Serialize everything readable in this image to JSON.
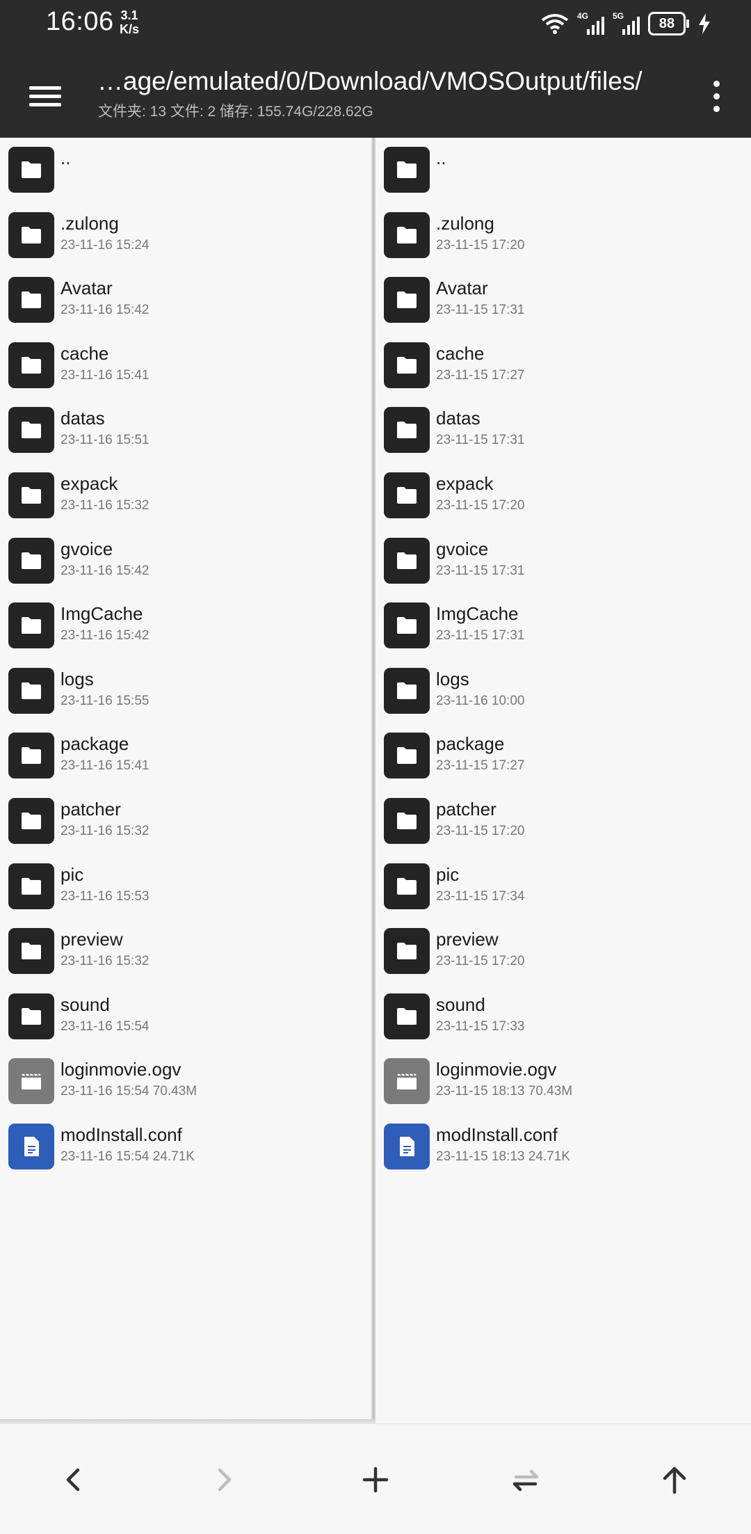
{
  "status_bar": {
    "time": "16:06",
    "speed_value": "3.1",
    "speed_unit": "K/s",
    "net_4g": "4G",
    "net_5g": "5G",
    "battery": "88"
  },
  "appbar": {
    "path": "…age/emulated/0/Download/VMOSOutput/files/",
    "info": "文件夹: 13  文件: 2  储存: 155.74G/228.62G"
  },
  "icons": {
    "menu": "hamburger-icon",
    "more": "more-vertical-icon",
    "folder": "folder-icon",
    "video": "video-icon",
    "doc": "document-icon",
    "back": "chevron-left-icon",
    "forward": "chevron-right-icon",
    "add": "plus-icon",
    "swap": "swap-icon",
    "up": "arrow-up-icon"
  },
  "colors": {
    "topbar": "#2b2b2b",
    "folder_icon": "#242424",
    "video_icon": "#7a7a7a",
    "doc_icon": "#2f5eb8"
  },
  "left_pane": {
    "items": [
      {
        "name": "..",
        "meta": ""
      },
      {
        "name": ".zulong",
        "meta": "23-11-16 15:24"
      },
      {
        "name": "Avatar",
        "meta": "23-11-16 15:42"
      },
      {
        "name": "cache",
        "meta": "23-11-16 15:41"
      },
      {
        "name": "datas",
        "meta": "23-11-16 15:51"
      },
      {
        "name": "expack",
        "meta": "23-11-16 15:32"
      },
      {
        "name": "gvoice",
        "meta": "23-11-16 15:42"
      },
      {
        "name": "ImgCache",
        "meta": "23-11-16 15:42"
      },
      {
        "name": "logs",
        "meta": "23-11-16 15:55"
      },
      {
        "name": "package",
        "meta": "23-11-16 15:41"
      },
      {
        "name": "patcher",
        "meta": "23-11-16 15:32"
      },
      {
        "name": "pic",
        "meta": "23-11-16 15:53"
      },
      {
        "name": "preview",
        "meta": "23-11-16 15:32"
      },
      {
        "name": "sound",
        "meta": "23-11-16 15:54"
      },
      {
        "name": "loginmovie.ogv",
        "meta": "23-11-16 15:54  70.43M"
      },
      {
        "name": "modInstall.conf",
        "meta": "23-11-16 15:54  24.71K"
      }
    ]
  },
  "right_pane": {
    "items": [
      {
        "name": "..",
        "meta": ""
      },
      {
        "name": ".zulong",
        "meta": "23-11-15 17:20"
      },
      {
        "name": "Avatar",
        "meta": "23-11-15 17:31"
      },
      {
        "name": "cache",
        "meta": "23-11-15 17:27"
      },
      {
        "name": "datas",
        "meta": "23-11-15 17:31"
      },
      {
        "name": "expack",
        "meta": "23-11-15 17:20"
      },
      {
        "name": "gvoice",
        "meta": "23-11-15 17:31"
      },
      {
        "name": "ImgCache",
        "meta": "23-11-15 17:31"
      },
      {
        "name": "logs",
        "meta": "23-11-16 10:00"
      },
      {
        "name": "package",
        "meta": "23-11-15 17:27"
      },
      {
        "name": "patcher",
        "meta": "23-11-15 17:20"
      },
      {
        "name": "pic",
        "meta": "23-11-15 17:34"
      },
      {
        "name": "preview",
        "meta": "23-11-15 17:20"
      },
      {
        "name": "sound",
        "meta": "23-11-15 17:33"
      },
      {
        "name": "loginmovie.ogv",
        "meta": "23-11-15 18:13  70.43M"
      },
      {
        "name": "modInstall.conf",
        "meta": "23-11-15 18:13  24.71K"
      }
    ]
  }
}
